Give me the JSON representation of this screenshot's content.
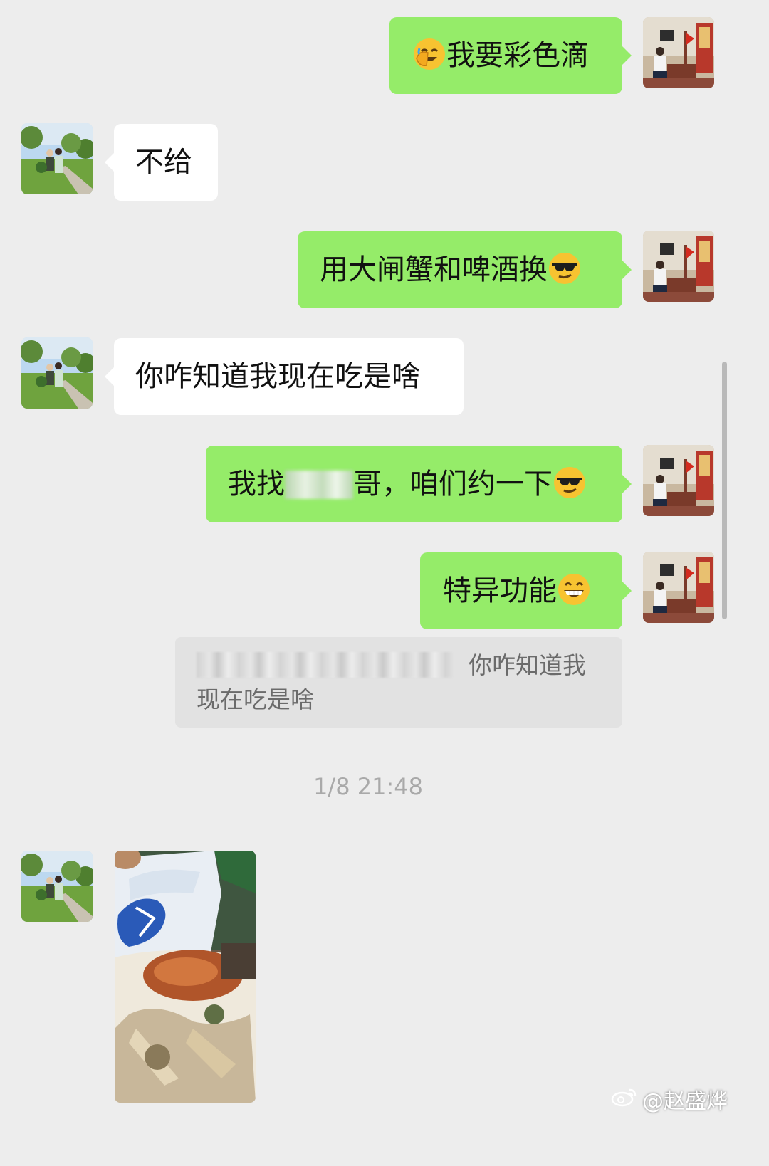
{
  "colors": {
    "background": "#ededed",
    "mine_bubble": "#95ec69",
    "their_bubble": "#ffffff"
  },
  "messages": [
    {
      "sender": "me",
      "text": "我要彩色滴",
      "emoji": "facepalm-laugh-emoji",
      "emoji_position": "before"
    },
    {
      "sender": "them",
      "text": "不给"
    },
    {
      "sender": "me",
      "text": "用大闸蟹和啤酒换",
      "emoji": "sunglasses-emoji",
      "emoji_position": "after"
    },
    {
      "sender": "them",
      "text": "你咋知道我现在吃是啥"
    },
    {
      "sender": "me",
      "text_before": "我找",
      "text_after": "哥，咱们约一下",
      "emoji": "sunglasses-emoji",
      "emoji_position": "after"
    },
    {
      "sender": "me",
      "text": "特异功能",
      "emoji": "grin-emoji",
      "emoji_position": "after"
    }
  ],
  "quote": {
    "text": "你咋知道我现在吃是啥"
  },
  "timestamp": "1/8 21:48",
  "photo_message": {
    "sender": "them",
    "icon": "beer-and-crab-photo"
  },
  "watermark": {
    "text": "@赵盛烨",
    "icon": "weibo-icon"
  }
}
